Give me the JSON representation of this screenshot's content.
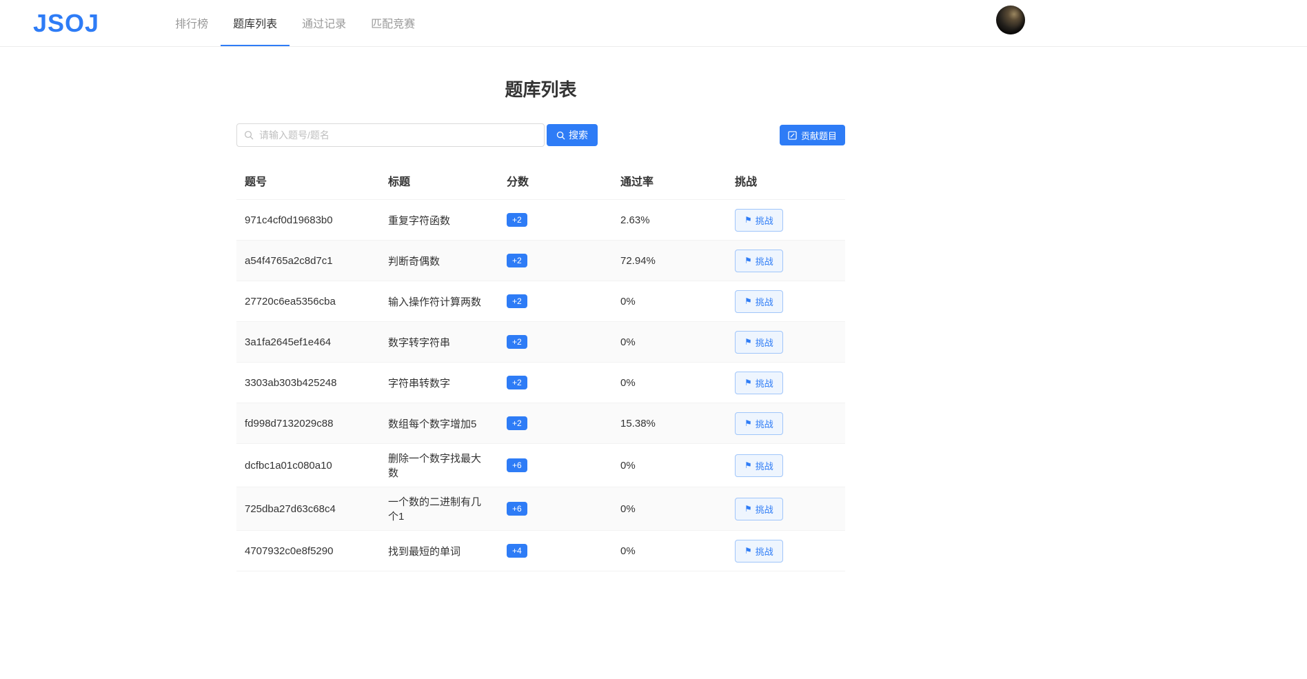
{
  "header": {
    "logo": "JSOJ",
    "nav": [
      {
        "label": "排行榜",
        "active": false
      },
      {
        "label": "题库列表",
        "active": true
      },
      {
        "label": "通过记录",
        "active": false
      },
      {
        "label": "匹配竞赛",
        "active": false
      }
    ]
  },
  "page": {
    "title": "题库列表",
    "search": {
      "placeholder": "请输入题号/题名",
      "button_label": "搜索"
    },
    "contribute_label": "贡献题目"
  },
  "table": {
    "columns": [
      "题号",
      "标题",
      "分数",
      "通过率",
      "挑战"
    ],
    "challenge_label": "挑战",
    "rows": [
      {
        "id": "971c4cf0d19683b0",
        "title": "重复字符函数",
        "score": "+2",
        "pass_rate": "2.63%"
      },
      {
        "id": "a54f4765a2c8d7c1",
        "title": "判断奇偶数",
        "score": "+2",
        "pass_rate": "72.94%"
      },
      {
        "id": "27720c6ea5356cba",
        "title": "输入操作符计算两数",
        "score": "+2",
        "pass_rate": "0%"
      },
      {
        "id": "3a1fa2645ef1e464",
        "title": "数字转字符串",
        "score": "+2",
        "pass_rate": "0%"
      },
      {
        "id": "3303ab303b425248",
        "title": "字符串转数字",
        "score": "+2",
        "pass_rate": "0%"
      },
      {
        "id": "fd998d7132029c88",
        "title": "数组每个数字增加5",
        "score": "+2",
        "pass_rate": "15.38%"
      },
      {
        "id": "dcfbc1a01c080a10",
        "title": "删除一个数字找最大数",
        "score": "+6",
        "pass_rate": "0%"
      },
      {
        "id": "725dba27d63c68c4",
        "title": "一个数的二进制有几个1",
        "score": "+6",
        "pass_rate": "0%"
      },
      {
        "id": "4707932c0e8f5290",
        "title": "找到最短的单词",
        "score": "+4",
        "pass_rate": "0%"
      }
    ]
  },
  "colors": {
    "primary": "#2e7cf6",
    "challenge_bg": "#eef5fe",
    "challenge_border": "#9fc5fa",
    "row_alt": "#fafafa"
  }
}
